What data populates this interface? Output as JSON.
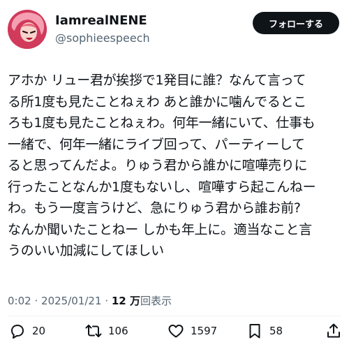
{
  "author": {
    "display_name": "IamrealNENE",
    "handle": "@sophieespeech"
  },
  "follow_label": "フォローする",
  "tweet": {
    "lines": [
      "アホか リュー君が挨拶で1発目に誰？なんて言って",
      "る所1度も見たことねぇわ あと誰かに噛んでるとこ",
      "ろも1度も見たことねぇわ。何年一緒にいて、仕事も",
      "一緒で、何年一緒にライブ回って、パーティーして",
      "ると思ってんだよ。りゅう君から誰かに喧嘩売りに",
      "行ったことなんか1度もないし、喧嘩すら起こんねー",
      "わ。もう一度言うけど、急にりゅう君から誰お前?",
      "なんか聞いたことねー しかも年上に。適当なこと言",
      "うのいい加減にしてほしい"
    ]
  },
  "meta": {
    "time": "0:02",
    "separator": "·",
    "date": "2025/01/21",
    "views_count": "12 万",
    "views_label": "回表示"
  },
  "actions": {
    "reply_count": "20",
    "repost_count": "106",
    "like_count": "1597",
    "bookmark_count": "58"
  },
  "icons": {
    "reply": "reply-icon",
    "repost": "repost-icon",
    "like": "heart-icon",
    "bookmark": "bookmark-icon",
    "share": "share-icon"
  },
  "colors": {
    "text": "#0f1419",
    "secondary": "#536471",
    "button_bg": "#0f1419",
    "button_text": "#ffffff"
  }
}
